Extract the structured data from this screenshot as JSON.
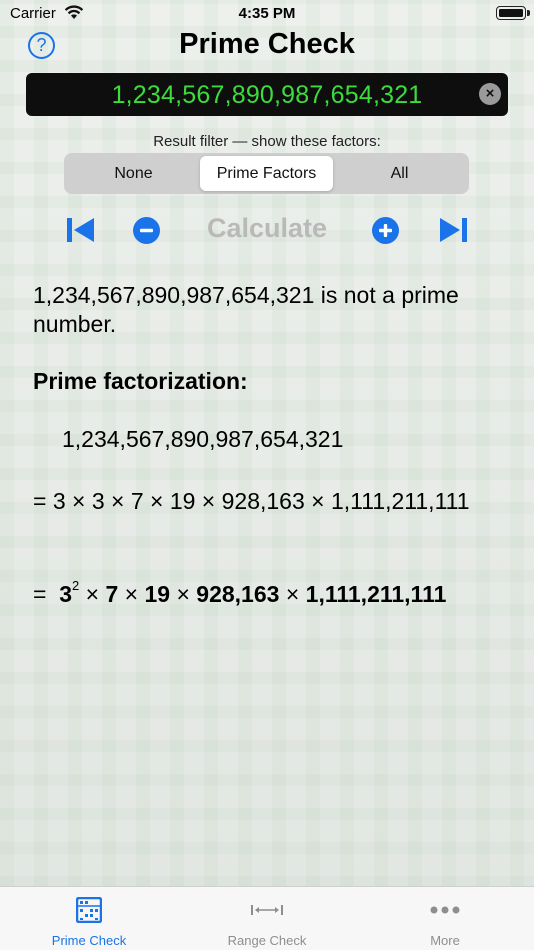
{
  "status_bar": {
    "carrier": "Carrier",
    "time": "4:35 PM"
  },
  "header": {
    "title": "Prime Check",
    "help_icon": "?"
  },
  "input": {
    "value": "1,234,567,890,987,654,321",
    "clear_icon": "×"
  },
  "filter": {
    "label": "Result filter — show these factors:",
    "options": [
      "None",
      "Prime Factors",
      "All"
    ],
    "selected": "Prime Factors"
  },
  "toolbar": {
    "calculate_label": "Calculate"
  },
  "result": {
    "statement": "1,234,567,890,987,654,321 is not a prime number.",
    "heading": "Prime factorization:",
    "number": "1,234,567,890,987,654,321",
    "expanded": "=  3 × 3 × 7 × 19 × 928,163 × 1,111,211,111",
    "compact": {
      "eq": "=",
      "base1": "3",
      "exp1": "2",
      "f2": "7",
      "f3": "19",
      "f4": "928,163",
      "f5": "1,111,211,111",
      "times": "×"
    }
  },
  "tabs": [
    {
      "label": "Prime Check",
      "icon": "abacus-icon",
      "active": true
    },
    {
      "label": "Range Check",
      "icon": "range-icon",
      "active": false
    },
    {
      "label": "More",
      "icon": "more-icon",
      "active": false
    }
  ],
  "colors": {
    "accent": "#1a73e8",
    "display_text": "#3ddc3d",
    "disabled": "#b9b9b9"
  }
}
